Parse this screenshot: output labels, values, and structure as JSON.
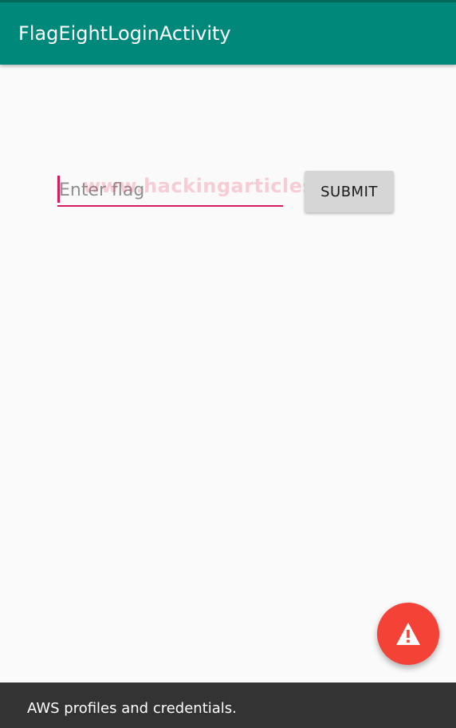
{
  "app_bar": {
    "title": "FlagEightLoginActivity",
    "color": "#00897b"
  },
  "flag_input": {
    "value": "",
    "placeholder": "Enter flag",
    "accent_color": "#d81b60"
  },
  "watermark": {
    "text": "www.hackingarticles.in"
  },
  "submit_button": {
    "label": "SUBMIT"
  },
  "fab": {
    "icon": "warning-icon",
    "color": "#f44336"
  },
  "snackbar": {
    "message": "AWS profiles and credentials."
  }
}
